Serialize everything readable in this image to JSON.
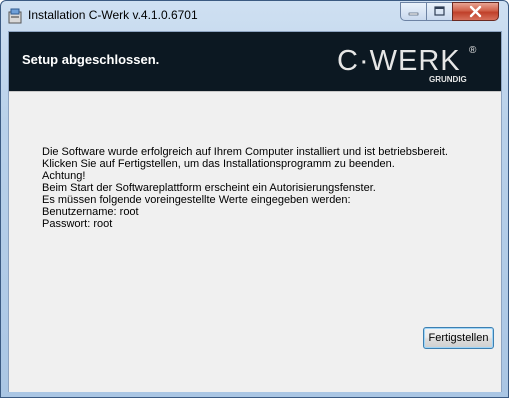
{
  "window": {
    "title": "Installation C-Werk v.4.1.0.6701",
    "close_glyph": "✕",
    "minimize_glyph": "–",
    "maximize_glyph": "□"
  },
  "header": {
    "title": "Setup abgeschlossen.",
    "logo_text": "C·WERK",
    "logo_sub": "GRUNDIG",
    "logo_registered": "®"
  },
  "message": {
    "lines": [
      "Die Software  wurde erfolgreich auf Ihrem Computer installiert und ist betriebsbereit.",
      "Klicken Sie auf Fertigstellen, um das Installationsprogramm zu beenden.",
      "Achtung!",
      "Beim Start der Softwareplattform erscheint ein Autorisierungsfenster.",
      "Es müssen folgende voreingestellte Werte eingegeben werden:",
      "Benutzername: root",
      "Passwort: root"
    ]
  },
  "footer": {
    "finish_label": "Fertigstellen"
  },
  "colors": {
    "header_bg": "#0c1822",
    "logo": "#e6e6e6",
    "accent_blue": "#3c7fb1",
    "close_red": "#c0402a"
  },
  "icons": {
    "app": "installer-icon",
    "close": "close-icon",
    "minimize": "minimize-icon",
    "maximize": "maximize-icon"
  }
}
